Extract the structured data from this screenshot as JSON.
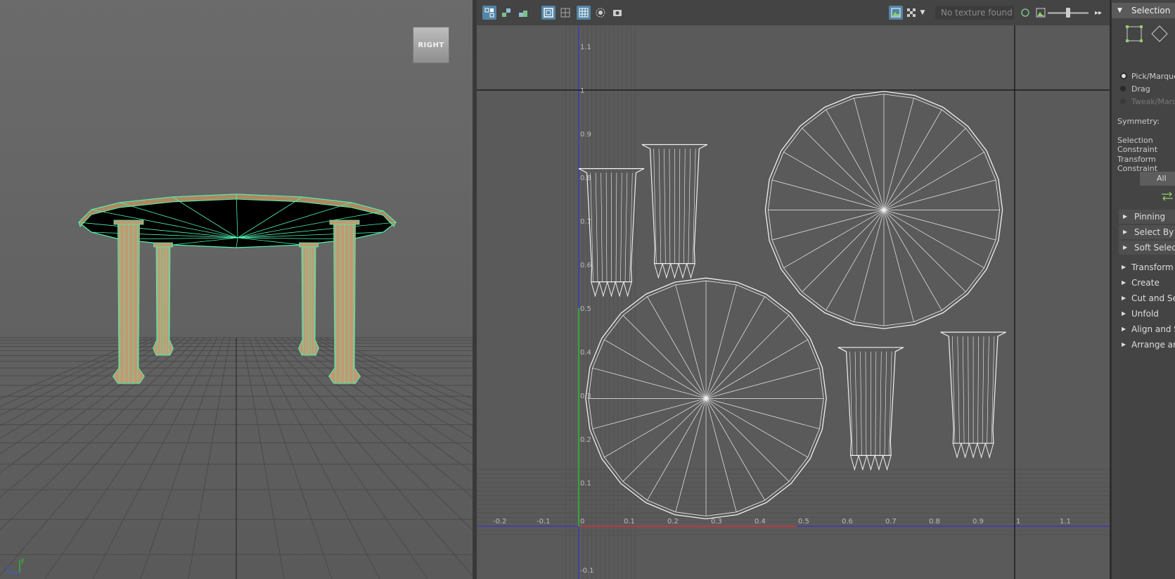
{
  "viewport3d": {
    "view_cube_label": "RIGHT",
    "axis_y": "y",
    "axis_z": "z"
  },
  "uv_editor": {
    "toolbar": {
      "icons": [
        "uv-shell-icon",
        "uv-tile-icon",
        "uv-flip-icon",
        "texture-borders-icon",
        "distortion-icon",
        "grid-toggle-icon",
        "shaded-icon",
        "snapshot-icon"
      ],
      "texture_display_icon": "image-icon",
      "checker_icon": "checker-icon",
      "texture_dropdown": "No texture found"
    },
    "axis_labels_x": [
      "-0.2",
      "-0.1",
      "0",
      "0.1",
      "0.2",
      "0.3",
      "0.4",
      "0.5",
      "0.6",
      "0.7",
      "0.8",
      "0.9",
      "1",
      "1.1",
      "1."
    ],
    "axis_labels_y": [
      "1.1",
      "1",
      "0.9",
      "0.8",
      "0.7",
      "0.6",
      "0.5",
      "0.4",
      "0.3",
      "0.2",
      "0.1",
      "-0.1"
    ],
    "colors": {
      "u_axis": "#e03030",
      "v_axis": "#30c030",
      "grid_axis": "#3535c8",
      "wire": "#f0f0f0"
    }
  },
  "uv_toolkit": {
    "header": "Selection",
    "radio_options": [
      "Pick/Marquee",
      "Drag",
      "Tweak/Marquee"
    ],
    "symmetry_label": "Symmetry:",
    "selection_constraint_label": "Selection Constraint",
    "transform_constraint_label": "Transform Constraint",
    "all_button": "All",
    "subsections": [
      "Pinning",
      "Select By Type",
      "Soft Selection"
    ],
    "sections": [
      "Transform",
      "Create",
      "Cut and Sew",
      "Unfold",
      "Align and Snap",
      "Arrange and Layout"
    ]
  }
}
